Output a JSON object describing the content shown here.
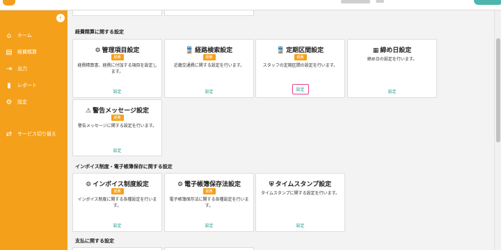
{
  "sidebar": {
    "collapse_icon": "chevron-left-icon",
    "items": [
      {
        "label": "ホーム",
        "icon": "home-icon",
        "glyph": "⌂"
      },
      {
        "label": "経費精算",
        "icon": "document-icon",
        "glyph": "▤"
      },
      {
        "label": "出力",
        "icon": "export-icon",
        "glyph": "⇥"
      },
      {
        "label": "レポート",
        "icon": "chart-icon",
        "glyph": "▮"
      },
      {
        "label": "設定",
        "icon": "gear-icon",
        "glyph": "⚙"
      },
      {
        "label": "サービス切り替え",
        "icon": "switch-icon",
        "glyph": "⇄"
      }
    ]
  },
  "sections": [
    {
      "title": "経費精算に関する設定",
      "cards": [
        {
          "title": "管理項目設定",
          "icon": "gears-icon",
          "glyph": "⚙",
          "badge": "経費",
          "desc": "経費精算書、経費に付加する項目を設定します。",
          "link": "設定"
        },
        {
          "title": "経路検索設定",
          "icon": "train-icon",
          "glyph": "🚆",
          "badge": "経費",
          "desc": "近畿交通費に関する設定を行います。",
          "link": "設定"
        },
        {
          "title": "定期区間設定",
          "icon": "train-icon",
          "glyph": "🚆",
          "badge": "経費",
          "desc": "スタッフの定期区間の設定を行います。",
          "link": "設定"
        },
        {
          "title": "締め日設定",
          "icon": "calendar-icon",
          "glyph": "▦",
          "badge": "経費",
          "desc": "締め日の設定を行います。",
          "link": "設定"
        },
        {
          "title": "警告メッセージ設定",
          "icon": "warning-icon",
          "glyph": "⚠",
          "badge": "経費",
          "desc": "警告メッセージに関する設定を行います。",
          "link": "設定"
        }
      ]
    },
    {
      "title": "インボイス制度・電子帳簿保存に関する設定",
      "cards": [
        {
          "title": "インボイス制度設定",
          "icon": "gears-icon",
          "glyph": "⚙",
          "badge": "経費",
          "desc": "インボイス制度に関する各種設定を行います。",
          "link": "設定"
        },
        {
          "title": "電子帳簿保存法設定",
          "icon": "gears-icon",
          "glyph": "⚙",
          "badge": "経費",
          "desc": "電子帳簿保存法に関する各種設定を行います。",
          "link": "設定"
        },
        {
          "title": "タイムスタンプ設定",
          "icon": "shield-icon",
          "glyph": "⛨",
          "badge": "経費",
          "desc": "タイムスタンプに関する設定を行います。",
          "link": "設定"
        }
      ]
    },
    {
      "title": "支払に関する設定"
    }
  ]
}
